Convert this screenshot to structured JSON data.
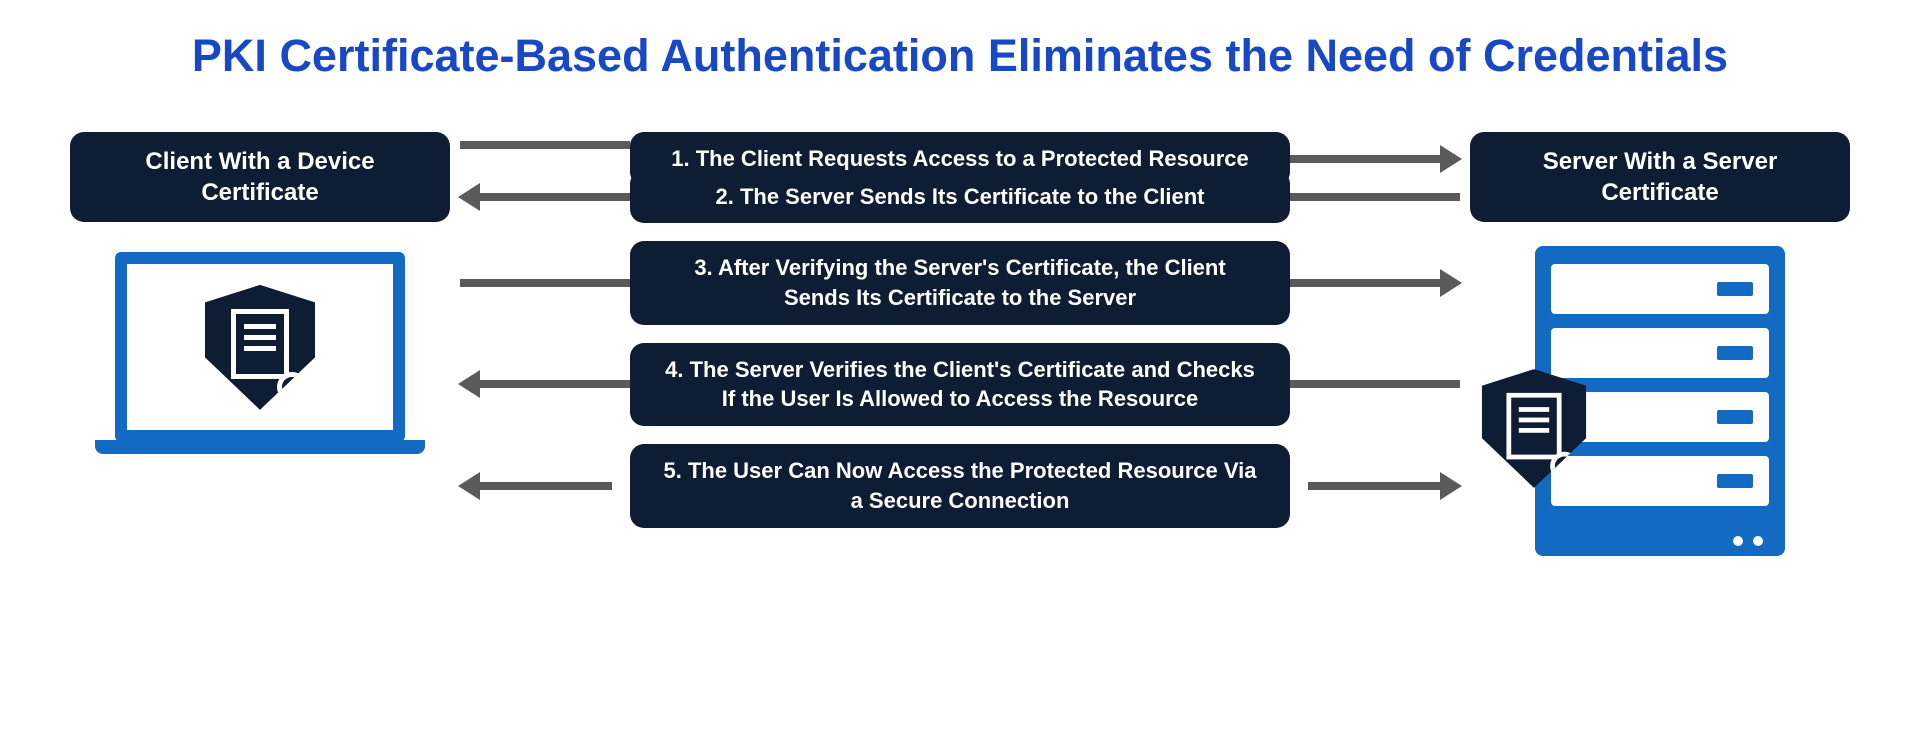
{
  "title": "PKI Certificate-Based Authentication Eliminates the Need of Credentials",
  "client": {
    "label": "Client With a Device Certificate"
  },
  "server": {
    "label": "Server With a Server Certificate"
  },
  "steps": [
    {
      "text": "1. The Client Requests Access to a Protected Resource",
      "direction": "right"
    },
    {
      "text": "2. The Server Sends Its Certificate to the Client",
      "direction": "left"
    },
    {
      "text": "3. After Verifying the Server's Certificate, the Client Sends Its Certificate to the Server",
      "direction": "right"
    },
    {
      "text": "4. The Server Verifies the Client's Certificate and Checks If the User Is Allowed to Access the Resource",
      "direction": "left"
    },
    {
      "text": "5. The User Can Now Access the Protected Resource Via a Secure Connection",
      "direction": "both"
    }
  ],
  "colors": {
    "title": "#1848c3",
    "box_bg": "#0e1d33",
    "accent": "#126ac2",
    "arrow": "#5a5a5a"
  },
  "icons": {
    "client": "laptop-with-certificate-shield-icon",
    "server": "server-rack-with-certificate-shield-icon"
  }
}
